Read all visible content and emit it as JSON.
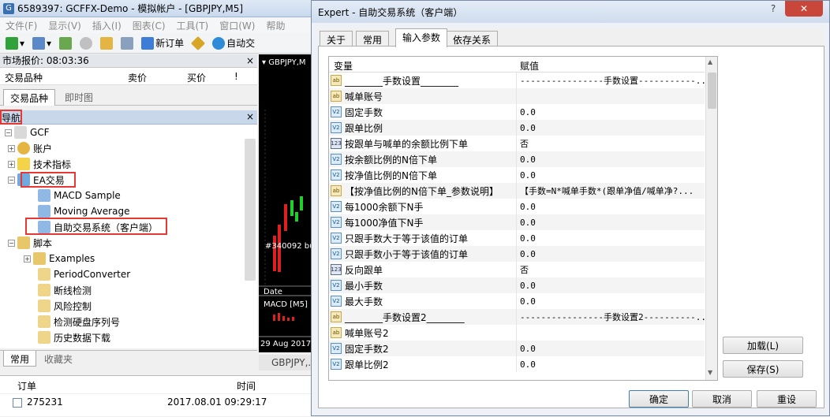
{
  "app": {
    "title": "6589397: GCFFX-Demo - 模拟帐户 - [GBPJPY,M5]",
    "menu": [
      "文件(F)",
      "显示(V)",
      "插入(I)",
      "图表(C)",
      "工具(T)",
      "窗口(W)",
      "帮助"
    ],
    "toolbar": {
      "new_order": "新订单",
      "auto_trade": "自动交"
    }
  },
  "market_watch": {
    "header": "市场报价: 08:03:36",
    "col_symbol": "交易品种",
    "col_bid": "卖价",
    "col_ask": "买价",
    "col_more": "!",
    "tabs": [
      "交易品种",
      "即时图"
    ]
  },
  "navigator": {
    "header": "导航",
    "root": "GCF",
    "accounts": "账户",
    "indicators": "技术指标",
    "ea": "EA交易",
    "ea_items": [
      "MACD Sample",
      "Moving Average",
      "自助交易系统（客户端）"
    ],
    "scripts": "脚本",
    "script_items": [
      "Examples",
      "PeriodConverter",
      "断线检测",
      "风险控制",
      "检测硬盘序列号",
      "历史数据下载"
    ],
    "tabs": [
      "常用",
      "收藏夹"
    ]
  },
  "chart": {
    "symbol": "GBPJPY,M",
    "label": "#340092 buy",
    "date_label": "Date",
    "macd": "MACD [M5]",
    "date": "29 Aug 2017",
    "tab": "GBPJPY,..."
  },
  "terminal": {
    "col_order": "订单",
    "col_time": "时间",
    "rows": [
      {
        "order": "275231",
        "time": "2017.08.01 09:29:17"
      }
    ]
  },
  "dialog": {
    "title": "Expert - 自助交易系统（客户端）",
    "tabs": [
      "关于",
      "常用",
      "输入参数",
      "依存关系"
    ],
    "col_var": "变量",
    "col_val": "赋值",
    "rows": [
      {
        "icon": "ab",
        "name": "________手数设置________",
        "value": "----------------手数设置-----------..."
      },
      {
        "icon": "ab",
        "name": "喊单账号",
        "value": ""
      },
      {
        "icon": "va",
        "name": "固定手数",
        "value": "0.0"
      },
      {
        "icon": "va",
        "name": "跟单比例",
        "value": "0.0"
      },
      {
        "icon": "n1",
        "name": "按跟单与喊单的余额比例下单",
        "value": "否"
      },
      {
        "icon": "va",
        "name": "按余额比例的N倍下单",
        "value": "0.0"
      },
      {
        "icon": "va",
        "name": "按净值比例的N倍下单",
        "value": "0.0"
      },
      {
        "icon": "ab",
        "name": "【按净值比例的N倍下单_参数说明】",
        "value": "【手数=N*喊单手数*(跟单净值/喊单净?..."
      },
      {
        "icon": "va",
        "name": "每1000余额下N手",
        "value": "0.0"
      },
      {
        "icon": "va",
        "name": "每1000净值下N手",
        "value": "0.0"
      },
      {
        "icon": "va",
        "name": "只跟手数大于等于该值的订单",
        "value": "0.0"
      },
      {
        "icon": "va",
        "name": "只跟手数小于等于该值的订单",
        "value": "0.0"
      },
      {
        "icon": "n1",
        "name": "反向跟单",
        "value": "否"
      },
      {
        "icon": "va",
        "name": "最小手数",
        "value": "0.0"
      },
      {
        "icon": "va",
        "name": "最大手数",
        "value": "0.0"
      },
      {
        "icon": "ab",
        "name": "________手数设置2________",
        "value": "----------------手数设置2----------..."
      },
      {
        "icon": "ab",
        "name": "喊单账号2",
        "value": ""
      },
      {
        "icon": "va",
        "name": "固定手数2",
        "value": "0.0"
      },
      {
        "icon": "va",
        "name": "跟单比例2",
        "value": "0.0"
      }
    ],
    "load": "加载(L)",
    "save": "保存(S)",
    "ok": "确定",
    "cancel": "取消",
    "reset": "重设"
  },
  "colors": {
    "highlight": "#e53935",
    "nav_header": "#c9d7ea",
    "chart_bg": "#000000",
    "candle_up": "#1fcf2a",
    "candle_down": "#e02020"
  }
}
